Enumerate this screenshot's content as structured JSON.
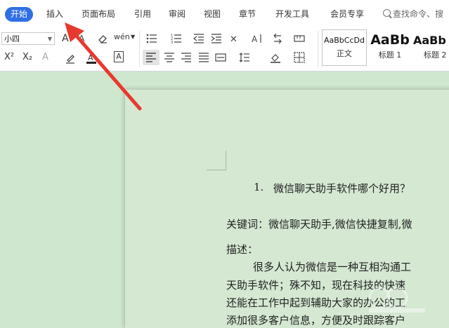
{
  "tabs": [
    {
      "label": "开始",
      "active": true
    },
    {
      "label": "插入",
      "active": false
    },
    {
      "label": "页面布局",
      "active": false
    },
    {
      "label": "引用",
      "active": false
    },
    {
      "label": "审阅",
      "active": false
    },
    {
      "label": "视图",
      "active": false
    },
    {
      "label": "章节",
      "active": false
    },
    {
      "label": "开发工具",
      "active": false
    },
    {
      "label": "会员专享",
      "active": false
    }
  ],
  "search_placeholder": "查找命令、搜",
  "ribbon": {
    "font_size": "小四",
    "font_grow": "A",
    "font_shrink": "A",
    "phonetic": "wén",
    "superscript": "X²",
    "subscript": "X₂",
    "text_effect": "A",
    "char_border": "A"
  },
  "styles": [
    {
      "preview": "AaBbCcDd",
      "name": "正文",
      "selected": true
    },
    {
      "preview": "AaBb",
      "name": "标题 1",
      "selected": false
    },
    {
      "preview": "AaBb",
      "name": "标题 2",
      "selected": false
    }
  ],
  "document": {
    "heading_number": "1.",
    "heading_text": "微信聊天助手软件哪个好用？",
    "keywords_line": "关键词：微信聊天助手,微信快捷复制,微",
    "desc_label": "描述：",
    "para_line1": "很多人认为微信是一种互相沟通工",
    "para_line2": "天助手软件；殊不知，现在科技的快速",
    "para_line3": "还能在工作中起到辅助大家的办公的工",
    "para_line4": "添加很多客户信息，方便及时跟踪客户"
  },
  "colors": {
    "active_tab": "#2f6fe4",
    "arrow": "#e8392e",
    "doc_background": "#cfe6cf"
  }
}
